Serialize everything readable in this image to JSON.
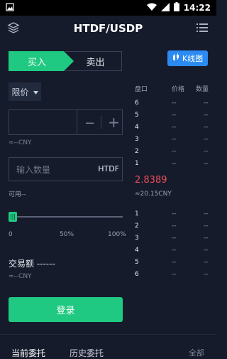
{
  "status_bar": {
    "time": "14:22"
  },
  "header": {
    "title": "HTDF/USDP"
  },
  "trade_tabs": {
    "buy": "买入",
    "sell": "卖出"
  },
  "kline_button": "K线图",
  "order_type": "限价",
  "price_input": {
    "value": "",
    "minus": "−",
    "plus": "+",
    "cny": "≈--CNY"
  },
  "quantity_input": {
    "placeholder": "输入数量",
    "unit": "HTDF"
  },
  "available": "可用--",
  "slider": {
    "value_percent": 0,
    "marks": [
      "0",
      "50%",
      "100%"
    ]
  },
  "trade_amount": "交易额 ------",
  "trade_amount_cny": "≈--CNY",
  "login_button": "登录",
  "order_book": {
    "headers": [
      "盘口",
      "价格",
      "数量"
    ],
    "asks": [
      {
        "level": "6",
        "price": "--",
        "qty": "--"
      },
      {
        "level": "5",
        "price": "--",
        "qty": "--"
      },
      {
        "level": "4",
        "price": "--",
        "qty": "--"
      },
      {
        "level": "3",
        "price": "--",
        "qty": "--"
      },
      {
        "level": "2",
        "price": "--",
        "qty": "--"
      },
      {
        "level": "1",
        "price": "--",
        "qty": "--"
      }
    ],
    "last_price": "2.8389",
    "last_price_cny": "≈20.15CNY",
    "bids": [
      {
        "level": "1",
        "price": "--",
        "qty": "--"
      },
      {
        "level": "2",
        "price": "--",
        "qty": "--"
      },
      {
        "level": "3",
        "price": "--",
        "qty": "--"
      },
      {
        "level": "4",
        "price": "--",
        "qty": "--"
      },
      {
        "level": "5",
        "price": "--",
        "qty": "--"
      },
      {
        "level": "6",
        "price": "--",
        "qty": "--"
      }
    ]
  },
  "bottom_tabs": {
    "current": "当前委托",
    "history": "历史委托",
    "all": "全部"
  },
  "colors": {
    "background": "#161b2b",
    "buy": "#20c982",
    "sell_price": "#ea4d5a",
    "kline": "#2b8bf2"
  }
}
